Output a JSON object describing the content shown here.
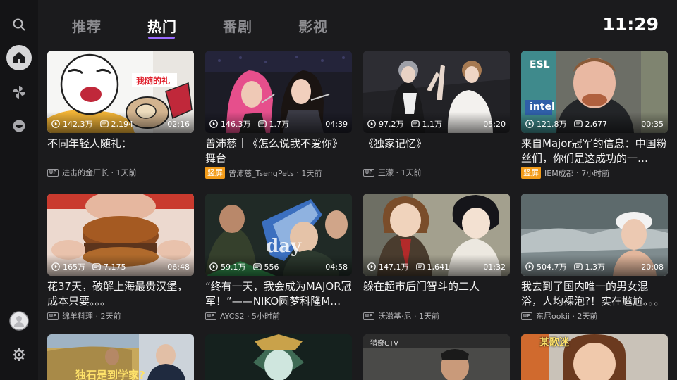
{
  "nav": {
    "tabs": [
      {
        "label": "推荐"
      },
      {
        "label": "热门"
      },
      {
        "label": "番剧"
      },
      {
        "label": "影视"
      }
    ],
    "active_tab": "热门",
    "accent_color": "#9b6bff"
  },
  "clock": "11:29",
  "sidebar": {
    "items": [
      "search-icon",
      "home-icon",
      "pinwheel-icon",
      "bowl-icon",
      "avatar",
      "gear-icon"
    ]
  },
  "badge_shu": "竖屏",
  "badge_color": "#f39c1a",
  "videos": [
    {
      "views": "142.3万",
      "danmaku": "2,194",
      "duration": "02:16",
      "title": "不同年轻人随礼：",
      "uploader": "进击的金厂长",
      "time": "1天前",
      "thumb_text": "我随的礼"
    },
    {
      "views": "146.3万",
      "danmaku": "1.7万",
      "duration": "04:39",
      "title": "曾沛慈｜《怎么说我不爱你》舞台",
      "uploader": "曾沛慈_TsengPets",
      "time": "1天前"
    },
    {
      "views": "97.2万",
      "danmaku": "1.1万",
      "duration": "05:20",
      "title": "《独家记忆》",
      "uploader": "王濛",
      "time": "1天前"
    },
    {
      "views": "121.8万",
      "danmaku": "2,677",
      "duration": "00:35",
      "title": "来自Major冠军的信息：中国粉丝们，你们是这成功的一…",
      "uploader": "IEM成都",
      "time": "7小时前",
      "thumb_text_a": "ESL",
      "thumb_text_b": "intel"
    },
    {
      "views": "165万",
      "danmaku": "7,175",
      "duration": "06:48",
      "title": "花37天，破解上海最贵汉堡，成本只要。。。",
      "uploader": "绵羊料理",
      "time": "2天前"
    },
    {
      "views": "59.1万",
      "danmaku": "556",
      "duration": "04:58",
      "title": "“终有一天，我会成为MAJOR冠军！”——NIKO圆梦科隆M…",
      "uploader": "AYCS2",
      "time": "5小时前",
      "thumb_text": "day"
    },
    {
      "views": "147.1万",
      "danmaku": "1,641",
      "duration": "01:32",
      "title": "躲在超市后门智斗的二人",
      "uploader": "沃滋基·尼",
      "time": "1天前"
    },
    {
      "views": "504.7万",
      "danmaku": "1.3万",
      "duration": "20:08",
      "title": "我去到了国内唯一的男女混浴，人均裸泡?！实在尴尬。。。",
      "uploader": "东尼ookii",
      "time": "2天前"
    },
    {
      "thumb_text": "独石是到学家?"
    },
    {},
    {
      "thumb_text": "猎奇CTV"
    },
    {
      "thumb_text": "某歌迷"
    }
  ]
}
